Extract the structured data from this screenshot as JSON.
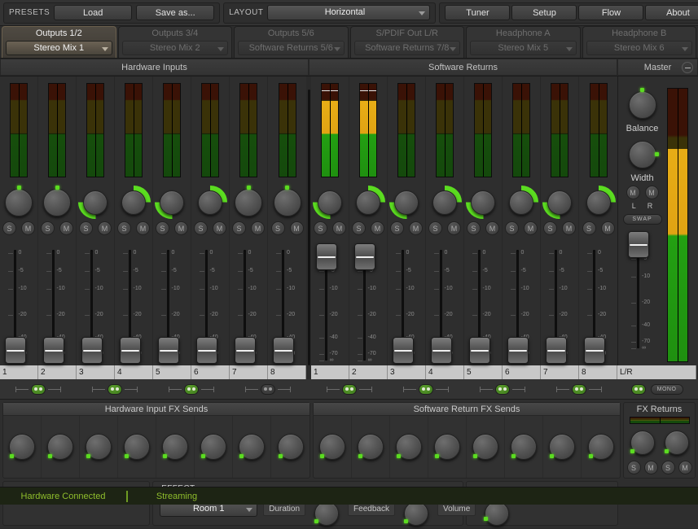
{
  "topbar": {
    "presets_label": "PRESETS",
    "load_label": "Load",
    "saveas_label": "Save as...",
    "layout_label": "LAYOUT",
    "layout_value": "Horizontal",
    "nav": [
      {
        "label": "Tuner"
      },
      {
        "label": "Setup"
      },
      {
        "label": "Flow"
      },
      {
        "label": "About"
      }
    ]
  },
  "tabs": [
    {
      "name": "Outputs 1/2",
      "source": "Stereo Mix 1",
      "active": true
    },
    {
      "name": "Outputs 3/4",
      "source": "Stereo Mix 2",
      "active": false
    },
    {
      "name": "Outputs 5/6",
      "source": "Software Returns 5/6",
      "active": false
    },
    {
      "name": "S/PDIF Out L/R",
      "source": "Software Returns 7/8",
      "active": false
    },
    {
      "name": "Headphone A",
      "source": "Stereo Mix 5",
      "active": false
    },
    {
      "name": "Headphone B",
      "source": "Stereo Mix 6",
      "active": false
    }
  ],
  "sections": {
    "hardware_inputs": "Hardware Inputs",
    "software_returns": "Software Returns",
    "master": "Master"
  },
  "fader_scale": [
    "0",
    "-5",
    "-10",
    "-20",
    "-40",
    "-70",
    "∞"
  ],
  "channel_buttons": {
    "solo": "S",
    "mute": "M"
  },
  "hardware_inputs": {
    "channels": [
      {
        "num": "1",
        "pan": "center",
        "meter_level": 46,
        "peak": 0,
        "fader_db": "-∞"
      },
      {
        "num": "2",
        "pan": "center",
        "meter_level": 46,
        "peak": 0,
        "fader_db": "-∞"
      },
      {
        "num": "3",
        "pan": "left",
        "meter_level": 46,
        "peak": 0,
        "fader_db": "-∞"
      },
      {
        "num": "4",
        "pan": "right",
        "meter_level": 46,
        "peak": 0,
        "fader_db": "-∞"
      },
      {
        "num": "5",
        "pan": "left",
        "meter_level": 46,
        "peak": 0,
        "fader_db": "-∞"
      },
      {
        "num": "6",
        "pan": "right",
        "meter_level": 46,
        "peak": 0,
        "fader_db": "-∞"
      },
      {
        "num": "7",
        "pan": "center",
        "meter_level": 46,
        "peak": 0,
        "fader_db": "-∞"
      },
      {
        "num": "8",
        "pan": "center",
        "meter_level": 46,
        "peak": 0,
        "fader_db": "-∞"
      }
    ],
    "links": [
      {
        "pair": "1-2",
        "on": true
      },
      {
        "pair": "3-4",
        "on": true
      },
      {
        "pair": "5-6",
        "on": true
      },
      {
        "pair": "7-8",
        "on": false
      }
    ]
  },
  "software_returns": {
    "channels": [
      {
        "num": "1",
        "pan": "left",
        "meter_level": 82,
        "peak": 92,
        "active": true,
        "fader_db": "0"
      },
      {
        "num": "2",
        "pan": "right",
        "meter_level": 82,
        "peak": 92,
        "active": true,
        "fader_db": "0"
      },
      {
        "num": "3",
        "pan": "left",
        "meter_level": 46,
        "peak": 0,
        "active": false,
        "fader_db": "-∞"
      },
      {
        "num": "4",
        "pan": "right",
        "meter_level": 46,
        "peak": 0,
        "active": false,
        "fader_db": "-∞"
      },
      {
        "num": "5",
        "pan": "left",
        "meter_level": 46,
        "peak": 0,
        "active": false,
        "fader_db": "-∞"
      },
      {
        "num": "6",
        "pan": "right",
        "meter_level": 46,
        "peak": 0,
        "active": false,
        "fader_db": "-∞"
      },
      {
        "num": "7",
        "pan": "left",
        "meter_level": 46,
        "peak": 0,
        "active": false,
        "fader_db": "-∞"
      },
      {
        "num": "8",
        "pan": "right",
        "meter_level": 46,
        "peak": 0,
        "active": false,
        "fader_db": "-∞"
      }
    ],
    "links": [
      {
        "pair": "1-2",
        "on": true
      },
      {
        "pair": "3-4",
        "on": true
      },
      {
        "pair": "5-6",
        "on": true
      },
      {
        "pair": "7-8",
        "on": true
      }
    ]
  },
  "master": {
    "balance_label": "Balance",
    "width_label": "Width",
    "left_label": "L",
    "right_label": "R",
    "mute_label": "M",
    "swap_label": "SWAP",
    "channel_label": "L/R",
    "mono_label": "MONO",
    "link_on": true,
    "meter_level": 78,
    "fader_db": "0"
  },
  "fx": {
    "hw_sends_title": "Hardware Input FX Sends",
    "sw_sends_title": "Software Return FX Sends",
    "hw_send_values": [
      2,
      2,
      2,
      2,
      2,
      2,
      2,
      2
    ],
    "sw_send_values": [
      2,
      2,
      2,
      2,
      2,
      2,
      2,
      2
    ],
    "returns_title": "FX Returns",
    "returns_meter_level": 52,
    "returns": [
      {
        "value": 3,
        "solo": "S",
        "mute": "M"
      },
      {
        "value": 3,
        "solo": "S",
        "mute": "M"
      }
    ]
  },
  "effect": {
    "title": "EFFECT",
    "preset": "Room 1",
    "duration_label": "Duration",
    "duration_value": 4,
    "feedback_label": "Feedback",
    "feedback_value": 4,
    "volume_label": "Volume",
    "volume_value": 8
  },
  "status": {
    "hardware": "Hardware Connected",
    "streaming": "Streaming"
  },
  "colors": {
    "accent_green": "#5bdc20",
    "status_text": "#8fbe2c",
    "meter_green": "#1f8f12",
    "meter_amber": "#d89a12",
    "meter_red": "#a02010"
  }
}
